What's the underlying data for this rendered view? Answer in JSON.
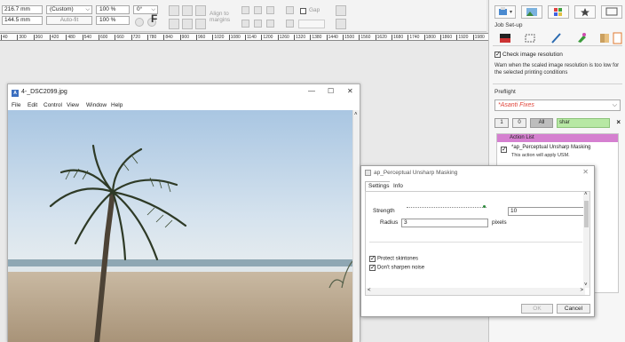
{
  "toolbar": {
    "width_value": "216.7 mm",
    "height_value": "144.5 mm",
    "preset_label": "(Custom)",
    "autofit_label": "Auto-fit",
    "zoom_x": "100 %",
    "zoom_y": "100 %",
    "rotation": "0°",
    "f_label": "F",
    "align_to_margins": "Align to\nmargins",
    "gap_label": "Gap"
  },
  "ruler": {
    "ticks": [
      "40",
      "300",
      "360",
      "420",
      "480",
      "540",
      "600",
      "660",
      "720",
      "780",
      "840",
      "900",
      "960",
      "1020",
      "1080",
      "1140",
      "1200",
      "1260",
      "1320",
      "1380",
      "1440",
      "1500",
      "1560",
      "1620",
      "1680",
      "1740",
      "1800",
      "1860",
      "1920",
      "1980"
    ]
  },
  "right_panel": {
    "section_title": "Job Set-up",
    "check_resolution_label": "Check image resolution",
    "check_resolution_checked": true,
    "warn_text_1": "Warn when the scaled image resolution is too low for",
    "warn_text_2": "the selected printing conditions",
    "preflight_label": "Preflight",
    "preflight_value": "*Asanti Fixes",
    "filter_btn_1": "1",
    "filter_btn_0": "0",
    "filter_btn_all": "All",
    "filter_search": "shar",
    "action_list_header": "Action List",
    "action_item_title": "*ap_Perceptual Unsharp Masking",
    "action_item_desc": "This action will apply USM.",
    "accent_color": "#d580d0",
    "preflight_color": "#e0453a"
  },
  "image_window": {
    "title": "4-_DSC2099.jpg",
    "logo_text": "A",
    "min": "—",
    "max": "☐",
    "close": "✕",
    "menu": [
      "File",
      "Edit",
      "Control",
      "View",
      "Window",
      "Help"
    ]
  },
  "dialog": {
    "title": "ap_Perceptual Unsharp Masking",
    "close": "✕",
    "tabs": [
      "Settings",
      "Info"
    ],
    "strength_label": "Strength",
    "strength_value": "10",
    "strength_fraction": 0.95,
    "radius_label": "Radius",
    "radius_value": "3",
    "radius_unit": "pixels",
    "protect_skintones_label": "Protect skintones",
    "protect_skintones_checked": true,
    "dont_sharpen_noise_label": "Don't sharpen noise",
    "dont_sharpen_noise_checked": true,
    "ok_label": "OK",
    "cancel_label": "Cancel"
  }
}
